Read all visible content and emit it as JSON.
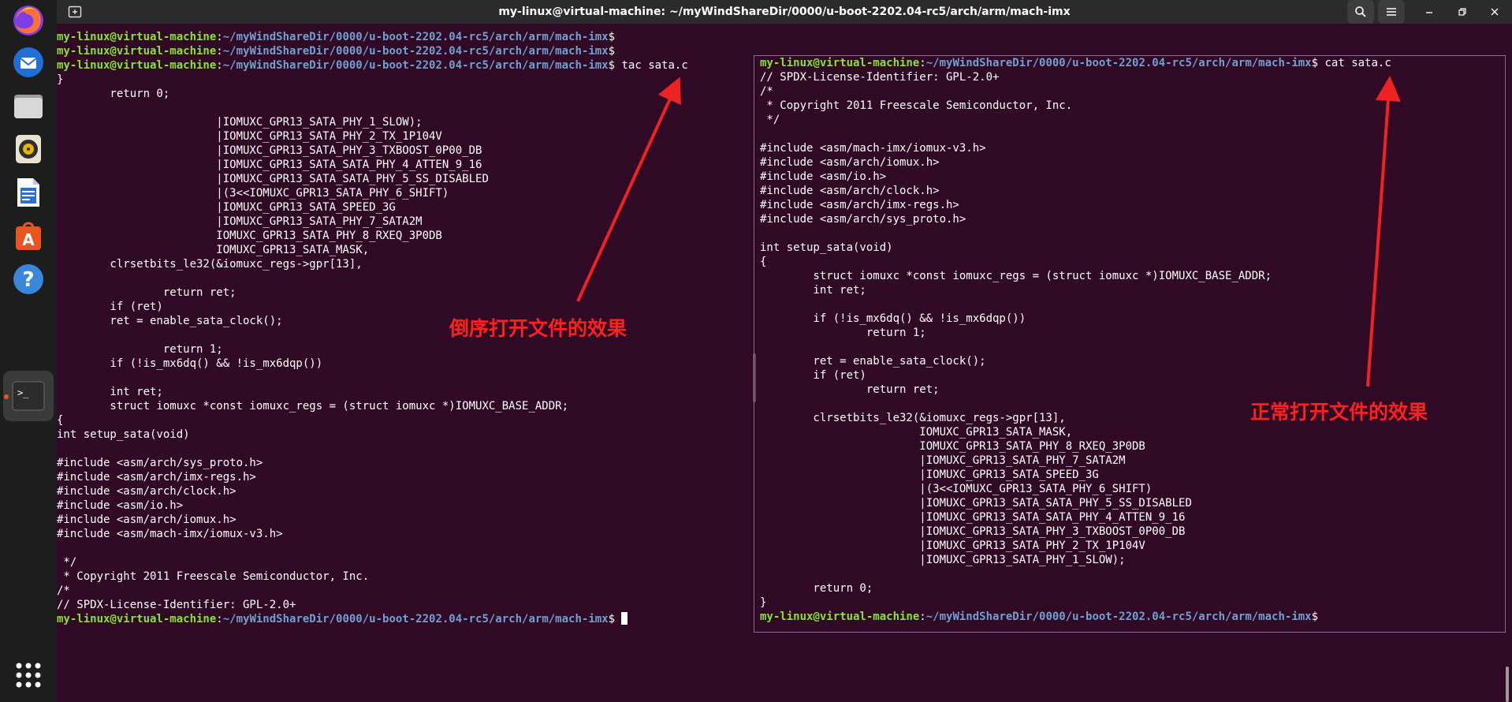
{
  "window": {
    "title": "my-linux@virtual-machine: ~/myWindShareDir/0000/u-boot-2202.04-rc5/arch/arm/mach-imx"
  },
  "dock": {
    "items": [
      "firefox-icon",
      "thunderbird-icon",
      "files-icon",
      "rhythmbox-icon",
      "libreoffice-writer-icon",
      "software-center-icon",
      "help-icon",
      "terminal-icon",
      "apps-grid-icon"
    ]
  },
  "prompt": {
    "user": "my-linux@virtual-machine",
    "sep": ":",
    "path": "~/myWindShareDir/0000/u-boot-2202.04-rc5/arch/arm/mach-imx",
    "dollar": "$"
  },
  "left_terminal": {
    "commands": [
      "",
      "",
      " tac sata.c",
      " "
    ],
    "output": "}\n        return 0;\n\n                        |IOMUXC_GPR13_SATA_PHY_1_SLOW);\n                        |IOMUXC_GPR13_SATA_PHY_2_TX_1P104V\n                        |IOMUXC_GPR13_SATA_PHY_3_TXBOOST_0P00_DB\n                        |IOMUXC_GPR13_SATA_SATA_PHY_4_ATTEN_9_16\n                        |IOMUXC_GPR13_SATA_SATA_PHY_5_SS_DISABLED\n                        |(3<<IOMUXC_GPR13_SATA_PHY_6_SHIFT)\n                        |IOMUXC_GPR13_SATA_SPEED_3G\n                        |IOMUXC_GPR13_SATA_PHY_7_SATA2M\n                        IOMUXC_GPR13_SATA_PHY_8_RXEQ_3P0DB\n                        IOMUXC_GPR13_SATA_MASK,\n        clrsetbits_le32(&iomuxc_regs->gpr[13],\n\n                return ret;\n        if (ret)\n        ret = enable_sata_clock();\n\n                return 1;\n        if (!is_mx6dq() && !is_mx6dqp())\n\n        int ret;\n        struct iomuxc *const iomuxc_regs = (struct iomuxc *)IOMUXC_BASE_ADDR;\n{\nint setup_sata(void)\n\n#include <asm/arch/sys_proto.h>\n#include <asm/arch/imx-regs.h>\n#include <asm/arch/clock.h>\n#include <asm/io.h>\n#include <asm/arch/iomux.h>\n#include <asm/mach-imx/iomux-v3.h>\n\n */\n * Copyright 2011 Freescale Semiconductor, Inc.\n/*\n// SPDX-License-Identifier: GPL-2.0+"
  },
  "right_terminal": {
    "command": " cat sata.c",
    "output": "// SPDX-License-Identifier: GPL-2.0+\n/*\n * Copyright 2011 Freescale Semiconductor, Inc.\n */\n\n#include <asm/mach-imx/iomux-v3.h>\n#include <asm/arch/iomux.h>\n#include <asm/io.h>\n#include <asm/arch/clock.h>\n#include <asm/arch/imx-regs.h>\n#include <asm/arch/sys_proto.h>\n\nint setup_sata(void)\n{\n        struct iomuxc *const iomuxc_regs = (struct iomuxc *)IOMUXC_BASE_ADDR;\n        int ret;\n\n        if (!is_mx6dq() && !is_mx6dqp())\n                return 1;\n\n        ret = enable_sata_clock();\n        if (ret)\n                return ret;\n\n        clrsetbits_le32(&iomuxc_regs->gpr[13],\n                        IOMUXC_GPR13_SATA_MASK,\n                        IOMUXC_GPR13_SATA_PHY_8_RXEQ_3P0DB\n                        |IOMUXC_GPR13_SATA_PHY_7_SATA2M\n                        |IOMUXC_GPR13_SATA_SPEED_3G\n                        |(3<<IOMUXC_GPR13_SATA_PHY_6_SHIFT)\n                        |IOMUXC_GPR13_SATA_SATA_PHY_5_SS_DISABLED\n                        |IOMUXC_GPR13_SATA_SATA_PHY_4_ATTEN_9_16\n                        |IOMUXC_GPR13_SATA_PHY_3_TXBOOST_0P00_DB\n                        |IOMUXC_GPR13_SATA_PHY_2_TX_1P104V\n                        |IOMUXC_GPR13_SATA_PHY_1_SLOW);\n\n        return 0;\n}",
    "final_command": ""
  },
  "annotations": {
    "left": "倒序打开文件的效果",
    "right": "正常打开文件的效果",
    "color": "#ff2020"
  },
  "colors": {
    "terminal_bg": "#300a24",
    "prompt_user": "#8ae234",
    "prompt_path": "#729fcf",
    "dock_bg": "#1d1d1d",
    "header_bg": "#2b2b2b",
    "accent": "#e95420"
  }
}
